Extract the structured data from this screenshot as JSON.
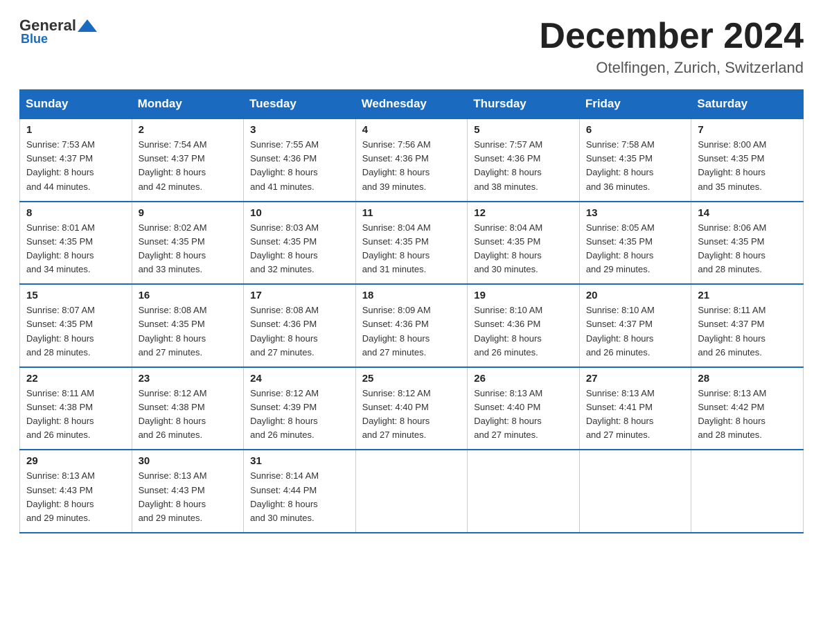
{
  "header": {
    "logo_general": "General",
    "logo_blue": "Blue",
    "month_year": "December 2024",
    "location": "Otelfingen, Zurich, Switzerland"
  },
  "days_of_week": [
    "Sunday",
    "Monday",
    "Tuesday",
    "Wednesday",
    "Thursday",
    "Friday",
    "Saturday"
  ],
  "weeks": [
    [
      {
        "day": "1",
        "sunrise": "7:53 AM",
        "sunset": "4:37 PM",
        "daylight": "8 hours and 44 minutes."
      },
      {
        "day": "2",
        "sunrise": "7:54 AM",
        "sunset": "4:37 PM",
        "daylight": "8 hours and 42 minutes."
      },
      {
        "day": "3",
        "sunrise": "7:55 AM",
        "sunset": "4:36 PM",
        "daylight": "8 hours and 41 minutes."
      },
      {
        "day": "4",
        "sunrise": "7:56 AM",
        "sunset": "4:36 PM",
        "daylight": "8 hours and 39 minutes."
      },
      {
        "day": "5",
        "sunrise": "7:57 AM",
        "sunset": "4:36 PM",
        "daylight": "8 hours and 38 minutes."
      },
      {
        "day": "6",
        "sunrise": "7:58 AM",
        "sunset": "4:35 PM",
        "daylight": "8 hours and 36 minutes."
      },
      {
        "day": "7",
        "sunrise": "8:00 AM",
        "sunset": "4:35 PM",
        "daylight": "8 hours and 35 minutes."
      }
    ],
    [
      {
        "day": "8",
        "sunrise": "8:01 AM",
        "sunset": "4:35 PM",
        "daylight": "8 hours and 34 minutes."
      },
      {
        "day": "9",
        "sunrise": "8:02 AM",
        "sunset": "4:35 PM",
        "daylight": "8 hours and 33 minutes."
      },
      {
        "day": "10",
        "sunrise": "8:03 AM",
        "sunset": "4:35 PM",
        "daylight": "8 hours and 32 minutes."
      },
      {
        "day": "11",
        "sunrise": "8:04 AM",
        "sunset": "4:35 PM",
        "daylight": "8 hours and 31 minutes."
      },
      {
        "day": "12",
        "sunrise": "8:04 AM",
        "sunset": "4:35 PM",
        "daylight": "8 hours and 30 minutes."
      },
      {
        "day": "13",
        "sunrise": "8:05 AM",
        "sunset": "4:35 PM",
        "daylight": "8 hours and 29 minutes."
      },
      {
        "day": "14",
        "sunrise": "8:06 AM",
        "sunset": "4:35 PM",
        "daylight": "8 hours and 28 minutes."
      }
    ],
    [
      {
        "day": "15",
        "sunrise": "8:07 AM",
        "sunset": "4:35 PM",
        "daylight": "8 hours and 28 minutes."
      },
      {
        "day": "16",
        "sunrise": "8:08 AM",
        "sunset": "4:35 PM",
        "daylight": "8 hours and 27 minutes."
      },
      {
        "day": "17",
        "sunrise": "8:08 AM",
        "sunset": "4:36 PM",
        "daylight": "8 hours and 27 minutes."
      },
      {
        "day": "18",
        "sunrise": "8:09 AM",
        "sunset": "4:36 PM",
        "daylight": "8 hours and 27 minutes."
      },
      {
        "day": "19",
        "sunrise": "8:10 AM",
        "sunset": "4:36 PM",
        "daylight": "8 hours and 26 minutes."
      },
      {
        "day": "20",
        "sunrise": "8:10 AM",
        "sunset": "4:37 PM",
        "daylight": "8 hours and 26 minutes."
      },
      {
        "day": "21",
        "sunrise": "8:11 AM",
        "sunset": "4:37 PM",
        "daylight": "8 hours and 26 minutes."
      }
    ],
    [
      {
        "day": "22",
        "sunrise": "8:11 AM",
        "sunset": "4:38 PM",
        "daylight": "8 hours and 26 minutes."
      },
      {
        "day": "23",
        "sunrise": "8:12 AM",
        "sunset": "4:38 PM",
        "daylight": "8 hours and 26 minutes."
      },
      {
        "day": "24",
        "sunrise": "8:12 AM",
        "sunset": "4:39 PM",
        "daylight": "8 hours and 26 minutes."
      },
      {
        "day": "25",
        "sunrise": "8:12 AM",
        "sunset": "4:40 PM",
        "daylight": "8 hours and 27 minutes."
      },
      {
        "day": "26",
        "sunrise": "8:13 AM",
        "sunset": "4:40 PM",
        "daylight": "8 hours and 27 minutes."
      },
      {
        "day": "27",
        "sunrise": "8:13 AM",
        "sunset": "4:41 PM",
        "daylight": "8 hours and 27 minutes."
      },
      {
        "day": "28",
        "sunrise": "8:13 AM",
        "sunset": "4:42 PM",
        "daylight": "8 hours and 28 minutes."
      }
    ],
    [
      {
        "day": "29",
        "sunrise": "8:13 AM",
        "sunset": "4:43 PM",
        "daylight": "8 hours and 29 minutes."
      },
      {
        "day": "30",
        "sunrise": "8:13 AM",
        "sunset": "4:43 PM",
        "daylight": "8 hours and 29 minutes."
      },
      {
        "day": "31",
        "sunrise": "8:14 AM",
        "sunset": "4:44 PM",
        "daylight": "8 hours and 30 minutes."
      },
      null,
      null,
      null,
      null
    ]
  ],
  "labels": {
    "sunrise": "Sunrise:",
    "sunset": "Sunset:",
    "daylight": "Daylight:"
  }
}
